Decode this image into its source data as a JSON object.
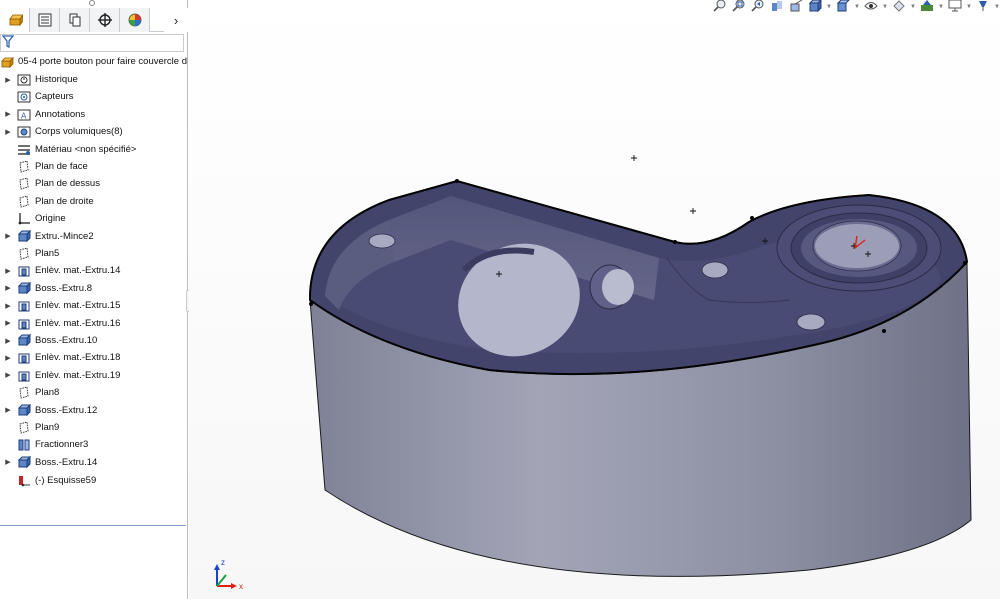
{
  "feature_manager": {
    "tabs": [
      {
        "name": "featuremanager-tab",
        "icon": "featuremanager-tree-icon",
        "active": true
      },
      {
        "name": "propertymanager-tab",
        "icon": "propertymanager-icon",
        "active": false
      },
      {
        "name": "configurationmanager-tab",
        "icon": "configurationmanager-icon",
        "active": false
      },
      {
        "name": "dimxpertmanager-tab",
        "icon": "dimxpert-crosshair-icon",
        "active": false
      },
      {
        "name": "displaymanager-tab",
        "icon": "displaymanager-palette-icon",
        "active": false
      }
    ],
    "more_tabs_glyph": "›",
    "filter_value": "",
    "part_name": "05-4 porte bouton pour faire couvercle d",
    "items": [
      {
        "label": "Historique",
        "expandable": true,
        "icon": "history-folder-icon"
      },
      {
        "label": "Capteurs",
        "expandable": false,
        "icon": "sensors-folder-icon"
      },
      {
        "label": "Annotations",
        "expandable": true,
        "icon": "annotations-folder-icon"
      },
      {
        "label": "Corps volumiques(8)",
        "expandable": true,
        "icon": "solid-bodies-folder-icon"
      },
      {
        "label": "Matériau <non spécifié>",
        "expandable": false,
        "icon": "material-icon"
      },
      {
        "label": "Plan de face",
        "expandable": false,
        "icon": "plane-icon"
      },
      {
        "label": "Plan de dessus",
        "expandable": false,
        "icon": "plane-icon"
      },
      {
        "label": "Plan de droite",
        "expandable": false,
        "icon": "plane-icon"
      },
      {
        "label": "Origine",
        "expandable": false,
        "icon": "origin-icon"
      },
      {
        "label": "Extru.-Mince2",
        "expandable": true,
        "icon": "boss-extrude-icon"
      },
      {
        "label": "Plan5",
        "expandable": false,
        "icon": "plane-icon"
      },
      {
        "label": "Enlèv. mat.-Extru.14",
        "expandable": true,
        "icon": "cut-extrude-icon"
      },
      {
        "label": "Boss.-Extru.8",
        "expandable": true,
        "icon": "boss-extrude-icon"
      },
      {
        "label": "Enlèv. mat.-Extru.15",
        "expandable": true,
        "icon": "cut-extrude-icon"
      },
      {
        "label": "Enlèv. mat.-Extru.16",
        "expandable": true,
        "icon": "cut-extrude-icon"
      },
      {
        "label": "Boss.-Extru.10",
        "expandable": true,
        "icon": "boss-extrude-icon"
      },
      {
        "label": "Enlèv. mat.-Extru.18",
        "expandable": true,
        "icon": "cut-extrude-icon"
      },
      {
        "label": "Enlèv. mat.-Extru.19",
        "expandable": true,
        "icon": "cut-extrude-icon"
      },
      {
        "label": "Plan8",
        "expandable": false,
        "icon": "plane-icon"
      },
      {
        "label": "Boss.-Extru.12",
        "expandable": true,
        "icon": "boss-extrude-icon"
      },
      {
        "label": "Plan9",
        "expandable": false,
        "icon": "plane-icon"
      },
      {
        "label": "Fractionner3",
        "expandable": false,
        "icon": "split-icon"
      },
      {
        "label": "Boss.-Extru.14",
        "expandable": true,
        "icon": "boss-extrude-icon"
      }
    ],
    "rolled_back_items": [
      {
        "label": "(-) Esquisse59",
        "expandable": false,
        "icon": "rollback-sketch-icon"
      }
    ]
  },
  "heads_up_toolbar": [
    {
      "name": "zoom-to-fit",
      "icon": "zoom-to-fit-icon",
      "dropdown": false
    },
    {
      "name": "zoom-to-area",
      "icon": "zoom-to-area-icon",
      "dropdown": false
    },
    {
      "name": "previous-view",
      "icon": "previous-view-icon",
      "dropdown": false
    },
    {
      "name": "section-view",
      "icon": "section-view-icon",
      "dropdown": false
    },
    {
      "name": "dynamic-annotation-views",
      "icon": "dynamic-annotation-icon",
      "dropdown": false
    },
    {
      "name": "view-orientation",
      "icon": "view-orientation-icon",
      "dropdown": true
    },
    {
      "name": "display-style",
      "icon": "display-style-icon",
      "dropdown": true
    },
    {
      "name": "hide-show-items",
      "icon": "hide-show-eye-icon",
      "dropdown": true
    },
    {
      "name": "edit-appearance",
      "icon": "edit-appearance-icon",
      "dropdown": true
    },
    {
      "name": "apply-scene",
      "icon": "apply-scene-icon",
      "dropdown": true
    },
    {
      "name": "view-settings",
      "icon": "view-settings-monitor-icon",
      "dropdown": true
    },
    {
      "name": "lights-cameras",
      "icon": "lights-icon",
      "dropdown": true
    }
  ],
  "colors": {
    "part_body": "#8b8da3",
    "part_cavity": "#3e3f66",
    "part_edge": "#111111",
    "tree_selection_line": "#7f9cc9"
  },
  "triad": {
    "x_label": "x",
    "z_label": "z"
  }
}
